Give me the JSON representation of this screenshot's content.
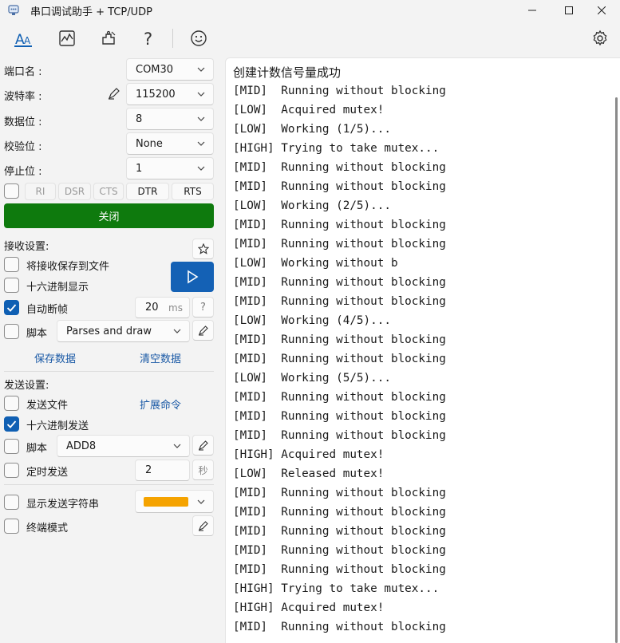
{
  "window": {
    "title": "串口调试助手 + TCP/UDP",
    "icons": {
      "app": "serial-port-app-icon",
      "minimize": "minimize-icon",
      "maximize": "maximize-icon",
      "close": "close-icon"
    }
  },
  "toolbar": {
    "icons": [
      "text-terminal-icon",
      "chart-icon",
      "plugin-icon",
      "help-icon",
      "smiley-icon",
      "settings-gear-icon"
    ]
  },
  "port": {
    "port_label": "端口名 :",
    "port_value": "COM30",
    "baud_label": "波特率 :",
    "baud_value": "115200",
    "databits_label": "数据位 :",
    "databits_value": "8",
    "parity_label": "校验位 :",
    "parity_value": "None",
    "stopbits_label": "停止位 :",
    "stopbits_value": "1",
    "signals": [
      "RI",
      "DSR",
      "CTS",
      "DTR",
      "RTS"
    ],
    "close_label": "关闭",
    "close_color": "#0e7a0d"
  },
  "receive": {
    "title": "接收设置:",
    "save_to_file": "将接收保存到文件",
    "hex_display": "十六进制显示",
    "auto_frame": "自动断帧",
    "auto_frame_value": "20",
    "auto_frame_unit": "ms",
    "help": "?",
    "script_label": "脚本",
    "script_value": "Parses and draw",
    "save_data": "保存数据",
    "clear_data": "清空数据"
  },
  "send": {
    "title": "发送设置:",
    "send_file": "发送文件",
    "extended_cmd": "扩展命令",
    "hex_send": "十六进制发送",
    "script_label": "脚本",
    "script_value": "ADD8",
    "timed_send": "定时发送",
    "timed_value": "2",
    "timed_unit": "秒",
    "show_send_string": "显示发送字符串",
    "send_color": "#f5a300",
    "terminal_mode": "终端模式"
  },
  "terminal": {
    "title": "创建计数信号量成功",
    "lines": [
      "[MID]  Running without blocking",
      "[LOW]  Acquired mutex!",
      "[LOW]  Working (1/5)...",
      "[HIGH] Trying to take mutex...",
      "[MID]  Running without blocking",
      "[MID]  Running without blocking",
      "[LOW]  Working (2/5)...",
      "[MID]  Running without blocking",
      "[MID]  Running without blocking",
      "[LOW]  Working without b",
      "[MID]  Running without blocking",
      "[MID]  Running without blocking",
      "[LOW]  Working (4/5)...",
      "[MID]  Running without blocking",
      "[MID]  Running without blocking",
      "[LOW]  Working (5/5)...",
      "[MID]  Running without blocking",
      "[MID]  Running without blocking",
      "[MID]  Running without blocking",
      "[HIGH] Acquired mutex!",
      "[LOW]  Released mutex!",
      "[MID]  Running without blocking",
      "[MID]  Running without blocking",
      "[MID]  Running without blocking",
      "[MID]  Running without blocking",
      "[MID]  Running without blocking",
      "[HIGH] Trying to take mutex...",
      "[HIGH] Acquired mutex!",
      "[MID]  Running without blocking"
    ]
  }
}
